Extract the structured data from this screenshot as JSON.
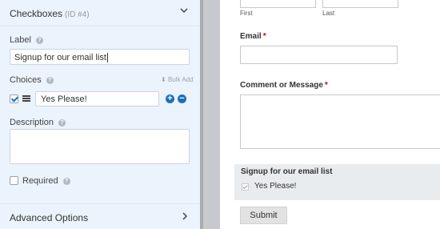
{
  "field_options": {
    "title": "Checkboxes",
    "id_text": "(ID #4)",
    "label_heading": "Label",
    "label_value": "Signup for our email list",
    "choices_heading": "Choices",
    "bulk_add": "Bulk Add",
    "choices": [
      {
        "label": "Yes Please!",
        "checked": true
      }
    ],
    "description_heading": "Description",
    "description_value": "",
    "required_label": "Required",
    "advanced_options": "Advanced Options"
  },
  "preview": {
    "name_sublabels": [
      "First",
      "Last"
    ],
    "email_label": "Email",
    "comment_label": "Comment or Message",
    "required_mark": "*",
    "checkbox_field_label": "Signup for our email list",
    "checkbox_choice": "Yes Please!",
    "submit_label": "Submit"
  },
  "icons": {
    "collapse": "chevron-down-icon",
    "expand": "chevron-right-icon",
    "help": "question-mark-icon",
    "drag": "drag-handle-icon",
    "add_choice": "plus-icon",
    "remove_choice": "minus-icon",
    "bulk_add": "download-icon"
  },
  "colors": {
    "panel_bg": "#ebf3fc",
    "accent": "#1d6fbb",
    "required": "#cc0000",
    "highlight": "#e9ecef"
  }
}
